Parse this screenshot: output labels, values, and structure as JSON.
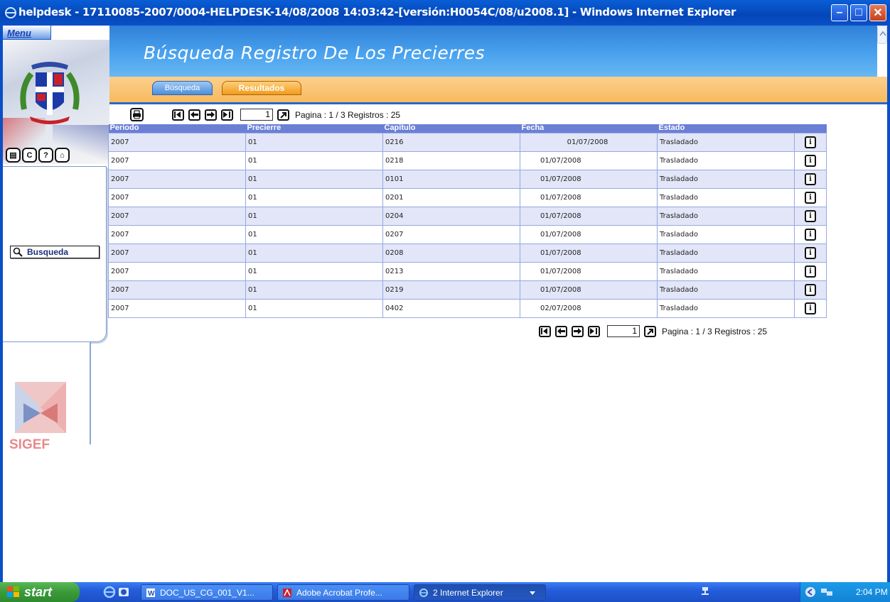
{
  "window": {
    "title": "helpdesk - 17110085-2007/0004-HELPDESK-14/08/2008 14:03:42-[versión:H0054C/08/u2008.1] - Windows Internet Explorer"
  },
  "sidebar": {
    "menu_label": "Menu",
    "logo_text": "SIGEF",
    "search_button": "Busqueda",
    "icons": [
      "document-icon",
      "refresh-icon",
      "help-icon",
      "home-icon"
    ]
  },
  "header": {
    "title": "Búsqueda Registro De Los Precierres"
  },
  "tabs": [
    {
      "label": "Búsqueda",
      "active": false
    },
    {
      "label": "Resultados",
      "active": true
    }
  ],
  "pager": {
    "page_input": "1",
    "status": "Pagina : 1 / 3 Registros : 25"
  },
  "table": {
    "headers": [
      "Periodo",
      "Precierre",
      "Capitulo",
      "Fecha",
      "Estado"
    ],
    "rows": [
      {
        "periodo": "2007",
        "precierre": "01",
        "capitulo": "0216",
        "fecha": "01/07/2008",
        "estado": "Trasladado"
      },
      {
        "periodo": "2007",
        "precierre": "01",
        "capitulo": "0218",
        "fecha": "01/07/2008",
        "estado": "Trasladado"
      },
      {
        "periodo": "2007",
        "precierre": "01",
        "capitulo": "0101",
        "fecha": "01/07/2008",
        "estado": "Trasladado"
      },
      {
        "periodo": "2007",
        "precierre": "01",
        "capitulo": "0201",
        "fecha": "01/07/2008",
        "estado": "Trasladado"
      },
      {
        "periodo": "2007",
        "precierre": "01",
        "capitulo": "0204",
        "fecha": "01/07/2008",
        "estado": "Trasladado"
      },
      {
        "periodo": "2007",
        "precierre": "01",
        "capitulo": "0207",
        "fecha": "01/07/2008",
        "estado": "Trasladado"
      },
      {
        "periodo": "2007",
        "precierre": "01",
        "capitulo": "0208",
        "fecha": "01/07/2008",
        "estado": "Trasladado"
      },
      {
        "periodo": "2007",
        "precierre": "01",
        "capitulo": "0213",
        "fecha": "01/07/2008",
        "estado": "Trasladado"
      },
      {
        "periodo": "2007",
        "precierre": "01",
        "capitulo": "0219",
        "fecha": "01/07/2008",
        "estado": "Trasladado"
      },
      {
        "periodo": "2007",
        "precierre": "01",
        "capitulo": "0402",
        "fecha": "02/07/2008",
        "estado": "Trasladado"
      }
    ],
    "info_icon": "i"
  },
  "taskbar": {
    "start_label": "start",
    "tasks": [
      {
        "label": "DOC_US_CG_001_V1...",
        "icon": "word-icon"
      },
      {
        "label": "Adobe Acrobat Profe...",
        "icon": "acrobat-icon"
      },
      {
        "label": "2 Internet Explorer",
        "icon": "ie-icon"
      }
    ],
    "clock": "2:04 PM"
  },
  "colors": {
    "header_blue": "#4aa2ee",
    "tab_orange": "#f7b95b",
    "table_header": "#6b7fd6",
    "row_alt": "#e2e6f8",
    "title_bar": "#0a5ed6",
    "taskbar": "#245edb",
    "start_green": "#3a9a3a"
  }
}
